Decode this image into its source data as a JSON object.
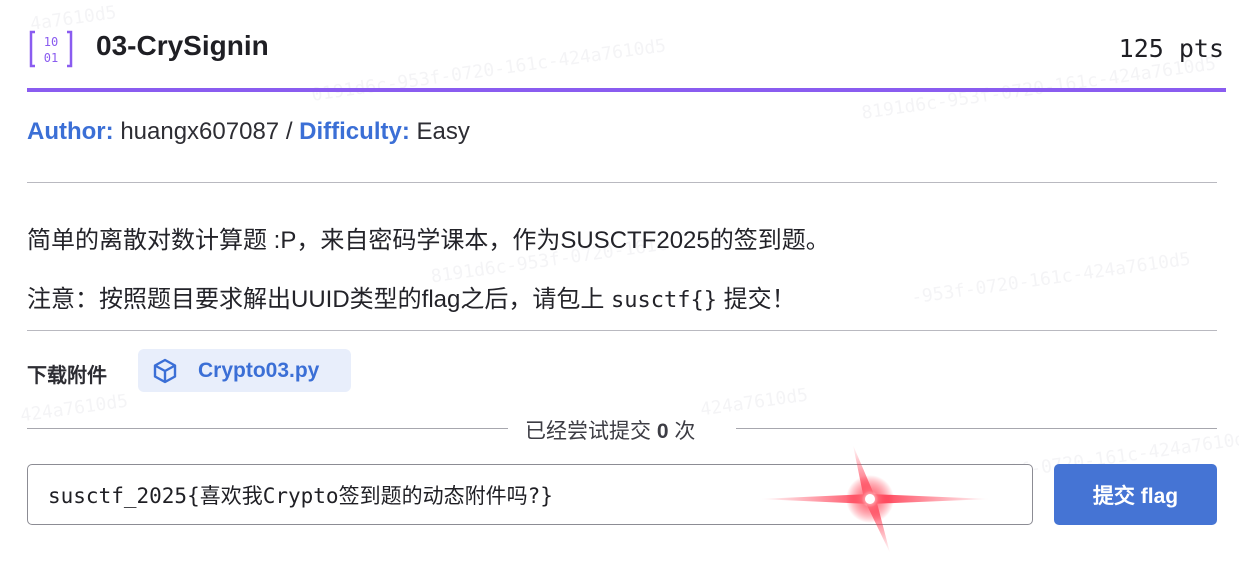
{
  "challenge": {
    "title": "03-CrySignin",
    "points": "125 pts",
    "author_label": "Author:",
    "author": "huangx607087",
    "separator": "/",
    "difficulty_label": "Difficulty:",
    "difficulty": "Easy",
    "accent_color": "#8a5cf0",
    "link_color": "#3b6fd6"
  },
  "description": {
    "line1": "简单的离散对数计算题 :P，来自密码学课本，作为SUSCTF2025的签到题。",
    "line2_prefix": "注意：按照题目要求解出UUID类型的flag之后，请包上 ",
    "line2_code": "susctf{}",
    "line2_suffix": " 提交！"
  },
  "attachments": {
    "label": "下载附件",
    "file_name": "Crypto03.py",
    "file_icon": "cube-icon"
  },
  "attempts": {
    "prefix": "已经尝试提交",
    "count": "0",
    "suffix": "次"
  },
  "submit": {
    "input_value": "susctf_2025{喜欢我Crypto签到题的动态附件吗?}",
    "button_label": "提交 flag",
    "button_color": "#4574d4"
  },
  "watermark": {
    "texts": [
      "4a7610d5",
      "0191d6c-953f-0720-161c-424a7610d5",
      "8191d6c-953f-0720-161c-424a7610d5",
      "8191d6c-953f-0720-161c",
      "424a7610d5",
      "-953f-0720-161c-424a7610d5"
    ]
  }
}
